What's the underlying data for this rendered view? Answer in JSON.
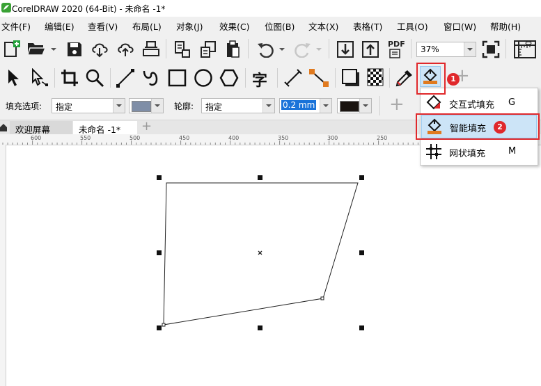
{
  "window": {
    "title": "CorelDRAW 2020 (64-Bit) - 未命名 -1*"
  },
  "menu": [
    "文件(F)",
    "编辑(E)",
    "查看(V)",
    "布局(L)",
    "对象(J)",
    "效果(C)",
    "位图(B)",
    "文本(X)",
    "表格(T)",
    "工具(O)",
    "窗口(W)",
    "帮助(H)"
  ],
  "standard_toolbar": {
    "pdf_label": "PDF",
    "zoom_value": "37%"
  },
  "toolbox": {
    "text_tool_glyph": "字"
  },
  "property_bar": {
    "fill_label": "填充选项:",
    "fill_mode": "指定",
    "fill_color": "#7f8ea7",
    "outline_label": "轮廓:",
    "outline_mode": "指定",
    "outline_width": "0.2 mm",
    "outline_color": "#1a1410"
  },
  "tabs": {
    "welcome": "欢迎屏幕",
    "document": "未命名 -1*"
  },
  "ruler": {
    "labels": [
      "600",
      "550",
      "500",
      "450",
      "400",
      "350",
      "300",
      "250"
    ]
  },
  "fill_flyout": {
    "items": [
      {
        "label": "交互式填充",
        "shortcut": "G"
      },
      {
        "label": "智能填充",
        "shortcut": ""
      },
      {
        "label": "网状填充",
        "shortcut": "M"
      }
    ]
  },
  "annotations": {
    "badge1": "1",
    "badge2": "2"
  },
  "colors": {
    "highlight": "#e0282b",
    "selected_bg": "#cce4f7",
    "selected_border": "#99c9ef"
  }
}
